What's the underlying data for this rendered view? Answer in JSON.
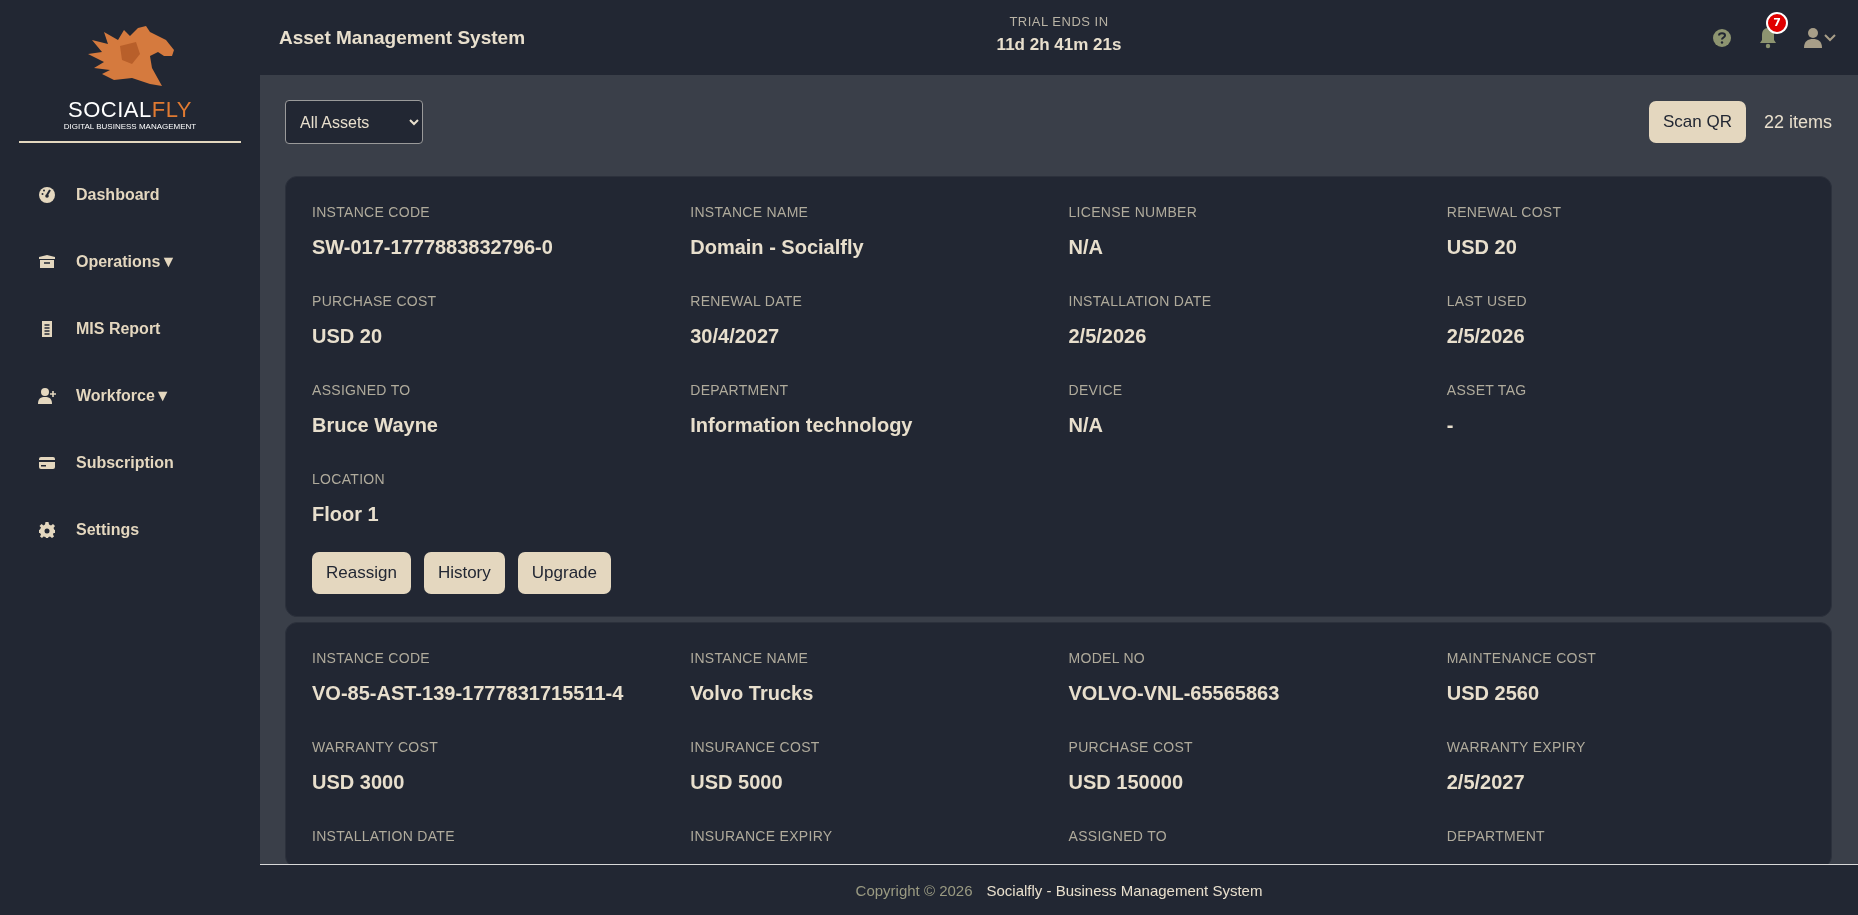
{
  "sidebar": {
    "logo": {
      "word_main": "SOCIAL",
      "word_accent": "FLY",
      "tagline": "DIGITAL BUSINESS MANAGEMENT"
    },
    "items": [
      {
        "label": "Dashboard"
      },
      {
        "label": "Operations▼"
      },
      {
        "label": "MIS Report"
      },
      {
        "label": "Workforce▼"
      },
      {
        "label": "Subscription"
      },
      {
        "label": "Settings"
      }
    ]
  },
  "header": {
    "title": "Asset Management System",
    "trial_label": "TRIAL ENDS IN",
    "trial_time": "11d 2h 41m 21s",
    "notification_count": "7"
  },
  "toolbar": {
    "filter": "All Assets",
    "scan_button": "Scan QR",
    "item_count": "22 items"
  },
  "cards": [
    {
      "fields": [
        {
          "label": "INSTANCE CODE",
          "value": "SW-017-1777883832796-0"
        },
        {
          "label": "INSTANCE NAME",
          "value": "Domain - Socialfly"
        },
        {
          "label": "LICENSE NUMBER",
          "value": "N/A"
        },
        {
          "label": "RENEWAL COST",
          "value": "USD 20"
        },
        {
          "label": "PURCHASE COST",
          "value": "USD 20"
        },
        {
          "label": "RENEWAL DATE",
          "value": "30/4/2027"
        },
        {
          "label": "INSTALLATION DATE",
          "value": "2/5/2026"
        },
        {
          "label": "LAST USED",
          "value": "2/5/2026"
        },
        {
          "label": "ASSIGNED TO",
          "value": "Bruce Wayne"
        },
        {
          "label": "DEPARTMENT",
          "value": "Information technology"
        },
        {
          "label": "DEVICE",
          "value": "N/A"
        },
        {
          "label": "ASSET TAG",
          "value": "-"
        },
        {
          "label": "LOCATION",
          "value": "Floor 1"
        }
      ],
      "buttons": [
        "Reassign",
        "History",
        "Upgrade"
      ]
    },
    {
      "fields": [
        {
          "label": "INSTANCE CODE",
          "value": "VO-85-AST-139-1777831715511-4"
        },
        {
          "label": "INSTANCE NAME",
          "value": "Volvo Trucks"
        },
        {
          "label": "MODEL NO",
          "value": "VOLVO-VNL-65565863"
        },
        {
          "label": "MAINTENANCE COST",
          "value": "USD 2560"
        },
        {
          "label": "WARRANTY COST",
          "value": "USD 3000"
        },
        {
          "label": "INSURANCE COST",
          "value": "USD 5000"
        },
        {
          "label": "PURCHASE COST",
          "value": "USD 150000"
        },
        {
          "label": "WARRANTY EXPIRY",
          "value": "2/5/2027"
        },
        {
          "label": "INSTALLATION DATE"
        },
        {
          "label": "INSURANCE EXPIRY"
        },
        {
          "label": "ASSIGNED TO"
        },
        {
          "label": "DEPARTMENT"
        }
      ]
    }
  ],
  "footer": {
    "copyright": "Copyright © 2026",
    "product": "Socialfly - Business Management System"
  }
}
